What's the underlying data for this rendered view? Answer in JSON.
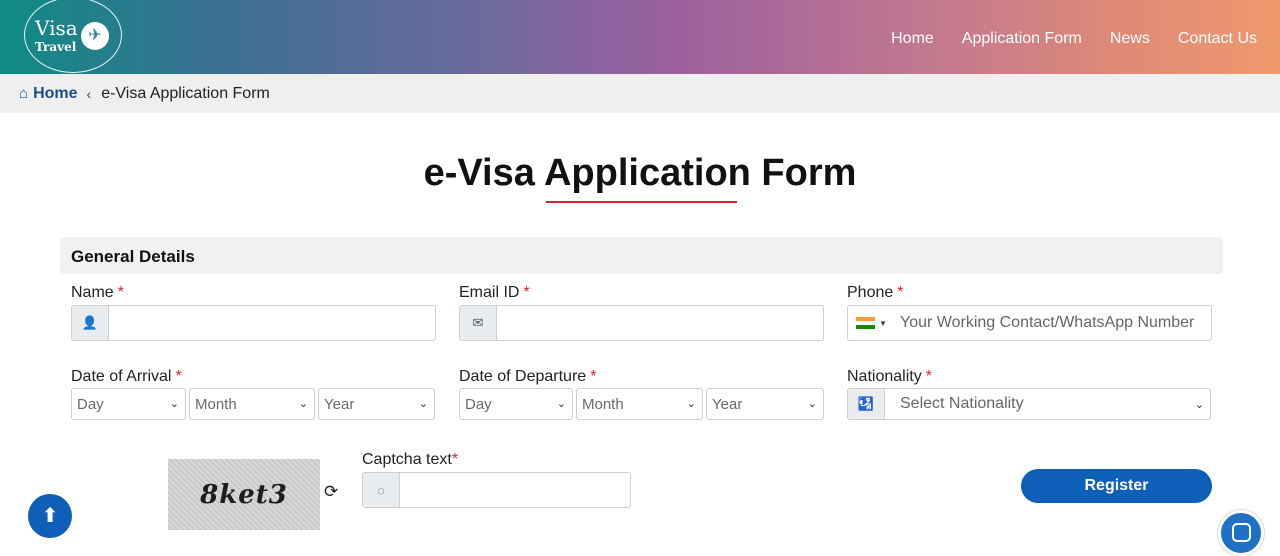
{
  "brand": {
    "line1": "Visa",
    "line2": "Travel"
  },
  "nav": [
    "Home",
    "Application Form",
    "News",
    "Contact Us"
  ],
  "breadcrumb": {
    "home": "Home",
    "current": "e-Visa Application Form"
  },
  "page_title": "e-Visa Application Form",
  "section": "General Details",
  "fields": {
    "name": {
      "label": "Name",
      "value": ""
    },
    "email": {
      "label": "Email ID",
      "value": ""
    },
    "phone": {
      "label": "Phone",
      "placeholder": "Your Working Contact/WhatsApp Number"
    },
    "arrival": {
      "label": "Date of Arrival",
      "day": "Day",
      "month": "Month",
      "year": "Year"
    },
    "departure": {
      "label": "Date of Departure",
      "day": "Day",
      "month": "Month",
      "year": "Year"
    },
    "nationality": {
      "label": "Nationality",
      "placeholder": "Select Nationality"
    },
    "captcha": {
      "label": "Captcha text",
      "image_text": "8ket3",
      "value": ""
    }
  },
  "required_mark": "*",
  "buttons": {
    "register": "Register"
  },
  "colors": {
    "accent": "#0d5fb8",
    "required": "#e2232d",
    "link": "#1c4f8a"
  }
}
